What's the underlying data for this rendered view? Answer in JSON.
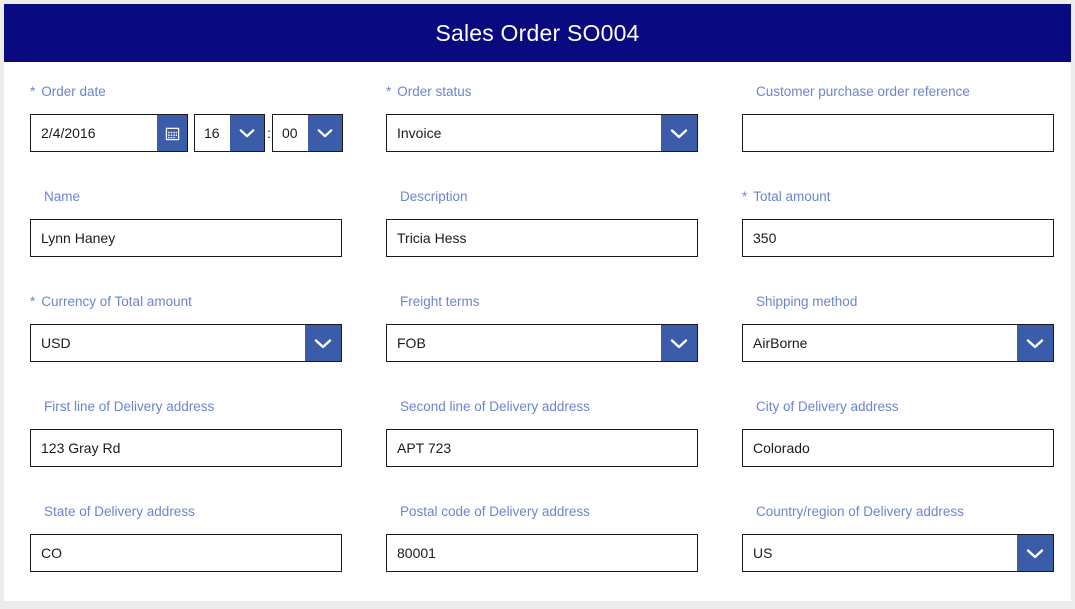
{
  "header": {
    "title": "Sales Order SO004",
    "background_color": "#0a0a80",
    "text_color": "#ffffff"
  },
  "theme": {
    "label_color": "#6b85cf",
    "dropdown_button_color": "#3b5ca8",
    "field_border_color": "#1a1a1a",
    "page_background": "#ececed",
    "card_background": "#ffffff"
  },
  "form": {
    "required_marker": "*",
    "rows": [
      {
        "fields": [
          {
            "label": "Order date",
            "required": true,
            "type": "datetime",
            "date_value": "2/4/2016",
            "hour_value": "16",
            "time_separator": ":",
            "minute_value": "00",
            "calendar_icon": "calendar-icon",
            "chevron_icon": "chevron-down-icon"
          },
          {
            "label": "Order status",
            "required": true,
            "type": "dropdown",
            "value": "Invoice",
            "chevron_icon": "chevron-down-icon"
          },
          {
            "label": "Customer purchase order reference",
            "required": false,
            "type": "text",
            "value": "",
            "placeholder": ""
          }
        ]
      },
      {
        "fields": [
          {
            "label": "Name",
            "required": false,
            "type": "text",
            "value": "Lynn Haney",
            "placeholder": ""
          },
          {
            "label": "Description",
            "required": false,
            "type": "text",
            "value": "Tricia Hess",
            "placeholder": ""
          },
          {
            "label": "Total amount",
            "required": true,
            "type": "text",
            "value": "350",
            "placeholder": ""
          }
        ]
      },
      {
        "fields": [
          {
            "label": "Currency of Total amount",
            "required": true,
            "type": "dropdown",
            "value": "USD",
            "chevron_icon": "chevron-down-icon"
          },
          {
            "label": "Freight terms",
            "required": false,
            "type": "dropdown",
            "value": "FOB",
            "chevron_icon": "chevron-down-icon"
          },
          {
            "label": "Shipping method",
            "required": false,
            "type": "dropdown",
            "value": "AirBorne",
            "chevron_icon": "chevron-down-icon"
          }
        ]
      },
      {
        "fields": [
          {
            "label": "First line of Delivery address",
            "required": false,
            "type": "text",
            "value": "123 Gray Rd",
            "placeholder": ""
          },
          {
            "label": "Second line of Delivery address",
            "required": false,
            "type": "text",
            "value": "APT 723",
            "placeholder": ""
          },
          {
            "label": "City of Delivery address",
            "required": false,
            "type": "text",
            "value": "Colorado",
            "placeholder": ""
          }
        ]
      },
      {
        "fields": [
          {
            "label": "State of Delivery address",
            "required": false,
            "type": "text",
            "value": "CO",
            "placeholder": ""
          },
          {
            "label": "Postal code of Delivery address",
            "required": false,
            "type": "text",
            "value": "80001",
            "placeholder": ""
          },
          {
            "label": "Country/region of Delivery address",
            "required": false,
            "type": "dropdown",
            "value": "US",
            "chevron_icon": "chevron-down-icon"
          }
        ]
      }
    ]
  }
}
